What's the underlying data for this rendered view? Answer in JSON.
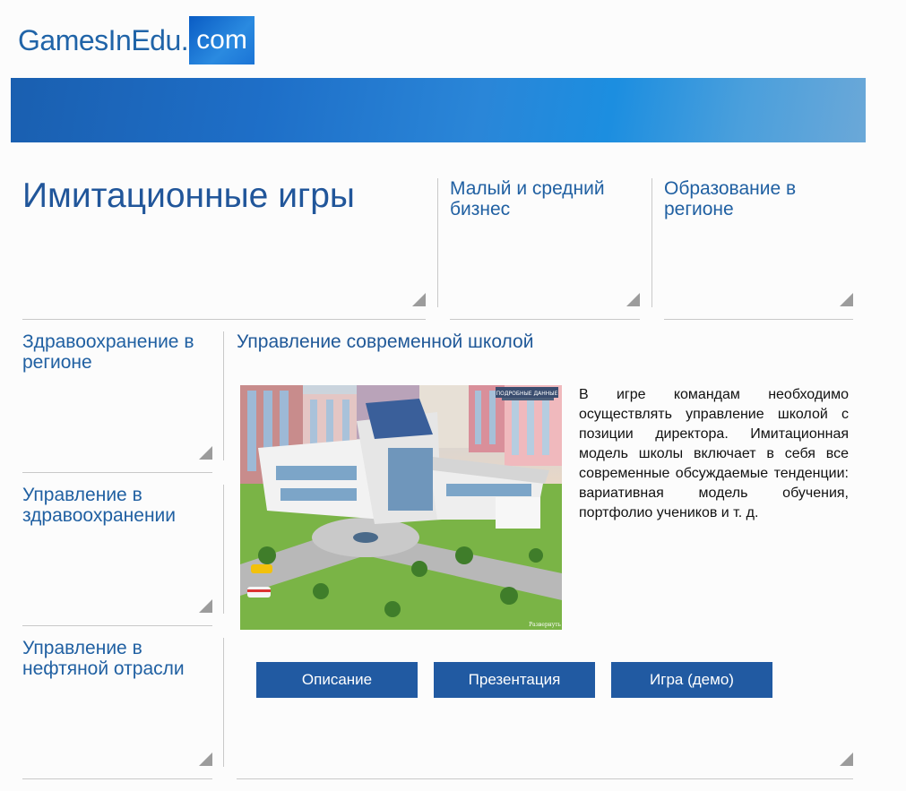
{
  "logo": {
    "name": "GamesInEdu.",
    "badge": "com"
  },
  "page_title": "Имитационные игры",
  "tiles": {
    "small_business": "Малый и средний бизнес",
    "education_region": "Образование в регионе",
    "healthcare_region": "Здравоохранение в регионе",
    "healthcare_management": "Управление в здравоохранении",
    "oil_management": "Управление в нефтяной отрасли"
  },
  "featured": {
    "title": "Управление современной школой",
    "image_caption": "ПОДРОБНЫЕ ДАННЫЕ",
    "image_corner": "Развернуть",
    "description": "В игре командам необходимо осуществлять управление школой с позиции директора. Имитационная модель школы включает в себя все современные обсуждаемые тенденции: вариативная модель обучения, портфолио учеников и т. д.",
    "buttons": {
      "description": "Описание",
      "presentation": "Презентация",
      "demo": "Игра (демо)"
    }
  },
  "colors": {
    "accent": "#215aa2",
    "link": "#2060a2",
    "banner": "#1e6fc8"
  }
}
